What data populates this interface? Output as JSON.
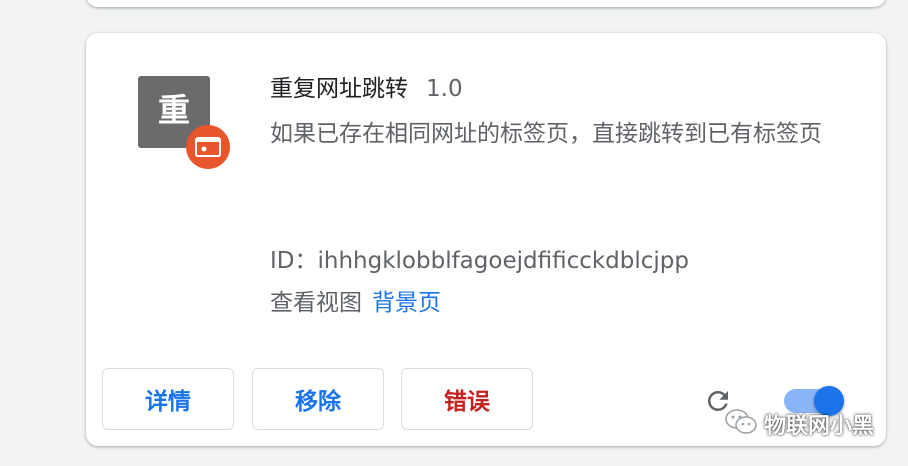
{
  "extension": {
    "icon_glyph": "重",
    "name": "重复网址跳转",
    "version": "1.0",
    "description": "如果已存在相同网址的标签页，直接跳转到已有标签页",
    "id_text": "ID：ihhhgklobblfagoejdfificckdblcjpp",
    "views_label": "查看视图",
    "views_link": "背景页",
    "enabled": true
  },
  "buttons": {
    "details": "详情",
    "remove": "移除",
    "errors": "错误"
  },
  "icons": {
    "badge": "console-badge-icon",
    "reload": "reload-icon",
    "watermark": "wechat-icon"
  },
  "colors": {
    "accent": "#1a73e8",
    "error": "#c5221f",
    "badge": "#e8552a",
    "icon_bg": "#6b6b6b"
  },
  "watermark": {
    "text": "物联网小黑"
  }
}
